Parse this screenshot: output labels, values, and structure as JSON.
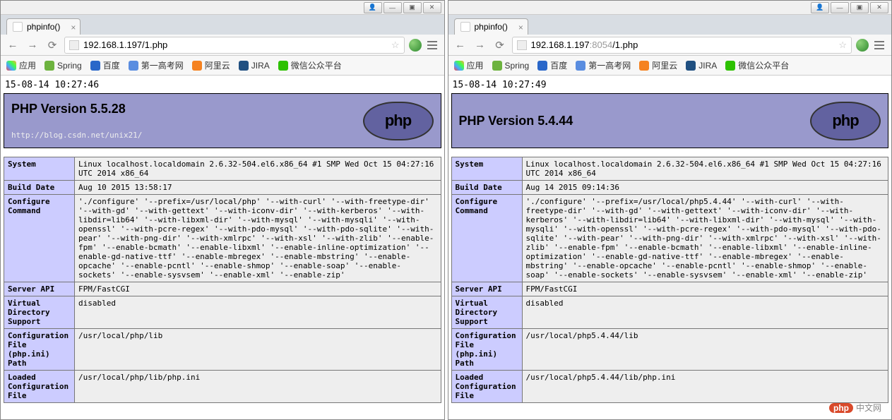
{
  "titlebar": {
    "user": "👤",
    "min": "—",
    "max": "▣",
    "close": "✕"
  },
  "bookmarks": {
    "apps": "应用",
    "items": [
      {
        "label": "Spring",
        "color": "#6db33f"
      },
      {
        "label": "百度",
        "color": "#2a67c9"
      },
      {
        "label": "第一高考网",
        "color": "#5a8de0"
      },
      {
        "label": "阿里云",
        "color": "#f58220"
      },
      {
        "label": "JIRA",
        "color": "#205081"
      },
      {
        "label": "微信公众平台",
        "color": "#2dc100"
      }
    ]
  },
  "left": {
    "tab": "phpinfo()",
    "url_host": "192.168.1.197",
    "url_port": "",
    "url_path": "/1.php",
    "timestamp": "15-08-14 10:27:46",
    "version_line": "PHP Version 5.5.28",
    "sublink": "http://blog.csdn.net/unix21/",
    "rows": [
      {
        "k": "System",
        "v": "Linux localhost.localdomain 2.6.32-504.el6.x86_64 #1 SMP Wed Oct 15 04:27:16 UTC 2014 x86_64"
      },
      {
        "k": "Build Date",
        "v": "Aug 10 2015 13:58:17"
      },
      {
        "k": "Configure Command",
        "v": "'./configure' '--prefix=/usr/local/php' '--with-curl' '--with-freetype-dir' '--with-gd' '--with-gettext' '--with-iconv-dir' '--with-kerberos' '--with-libdir=lib64' '--with-libxml-dir' '--with-mysql' '--with-mysqli' '--with-openssl' '--with-pcre-regex' '--with-pdo-mysql' '--with-pdo-sqlite' '--with-pear' '--with-png-dir' '--with-xmlrpc' '--with-xsl' '--with-zlib' '--enable-fpm' '--enable-bcmath' '--enable-libxml' '--enable-inline-optimization' '--enable-gd-native-ttf' '--enable-mbregex' '--enable-mbstring' '--enable-opcache' '--enable-pcntl' '--enable-shmop' '--enable-soap' '--enable-sockets' '--enable-sysvsem' '--enable-xml' '--enable-zip'"
      },
      {
        "k": "Server API",
        "v": "FPM/FastCGI"
      },
      {
        "k": "Virtual Directory Support",
        "v": "disabled"
      },
      {
        "k": "Configuration File (php.ini) Path",
        "v": "/usr/local/php/lib"
      },
      {
        "k": "Loaded Configuration File",
        "v": "/usr/local/php/lib/php.ini"
      }
    ]
  },
  "right": {
    "tab": "phpinfo()",
    "url_host": "192.168.1.197",
    "url_port": ":8054",
    "url_path": "/1.php",
    "timestamp": "15-08-14 10:27:49",
    "version_line": "PHP Version 5.4.44",
    "sublink": "",
    "rows": [
      {
        "k": "System",
        "v": "Linux localhost.localdomain 2.6.32-504.el6.x86_64 #1 SMP Wed Oct 15 04:27:16 UTC 2014 x86_64"
      },
      {
        "k": "Build Date",
        "v": "Aug 14 2015 09:14:36"
      },
      {
        "k": "Configure Command",
        "v": "'./configure' '--prefix=/usr/local/php5.4.44' '--with-curl' '--with-freetype-dir' '--with-gd' '--with-gettext' '--with-iconv-dir' '--with-kerberos' '--with-libdir=lib64' '--with-libxml-dir' '--with-mysql' '--with-mysqli' '--with-openssl' '--with-pcre-regex' '--with-pdo-mysql' '--with-pdo-sqlite' '--with-pear' '--with-png-dir' '--with-xmlrpc' '--with-xsl' '--with-zlib' '--enable-fpm' '--enable-bcmath' '--enable-libxml' '--enable-inline-optimization' '--enable-gd-native-ttf' '--enable-mbregex' '--enable-mbstring' '--enable-opcache' '--enable-pcntl' '--enable-shmop' '--enable-soap' '--enable-sockets' '--enable-sysvsem' '--enable-xml' '--enable-zip'"
      },
      {
        "k": "Server API",
        "v": "FPM/FastCGI"
      },
      {
        "k": "Virtual Directory Support",
        "v": "disabled"
      },
      {
        "k": "Configuration File (php.ini) Path",
        "v": "/usr/local/php5.4.44/lib"
      },
      {
        "k": "Loaded Configuration File",
        "v": "/usr/local/php5.4.44/lib/php.ini"
      }
    ]
  },
  "watermark": {
    "logo": "php",
    "text": "中文网"
  }
}
